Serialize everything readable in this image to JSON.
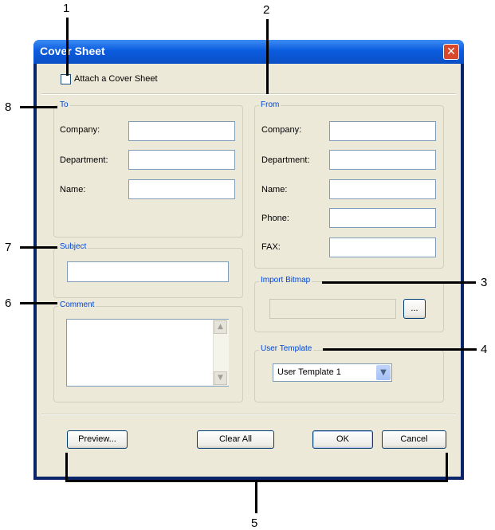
{
  "window": {
    "title": "Cover Sheet",
    "close_symbol": "✕"
  },
  "attach": {
    "label": "Attach a Cover Sheet",
    "checked": false
  },
  "to_group": {
    "legend": "To",
    "fields": [
      {
        "label": "Company:",
        "value": ""
      },
      {
        "label": "Department:",
        "value": ""
      },
      {
        "label": "Name:",
        "value": ""
      }
    ]
  },
  "from_group": {
    "legend": "From",
    "fields": [
      {
        "label": "Company:",
        "value": ""
      },
      {
        "label": "Department:",
        "value": ""
      },
      {
        "label": "Name:",
        "value": ""
      },
      {
        "label": "Phone:",
        "value": ""
      },
      {
        "label": "FAX:",
        "value": ""
      }
    ]
  },
  "subject": {
    "legend": "Subject",
    "value": ""
  },
  "comment": {
    "legend": "Comment",
    "value": ""
  },
  "import_bitmap": {
    "legend": "Import Bitmap",
    "path": "",
    "browse_label": "..."
  },
  "user_template": {
    "legend": "User Template",
    "selected": "User Template 1"
  },
  "buttons": {
    "preview": "Preview...",
    "clear_all": "Clear All",
    "ok": "OK",
    "cancel": "Cancel"
  },
  "callouts": {
    "n1": "1",
    "n2": "2",
    "n3": "3",
    "n4": "4",
    "n5": "5",
    "n6": "6",
    "n7": "7",
    "n8": "8"
  }
}
